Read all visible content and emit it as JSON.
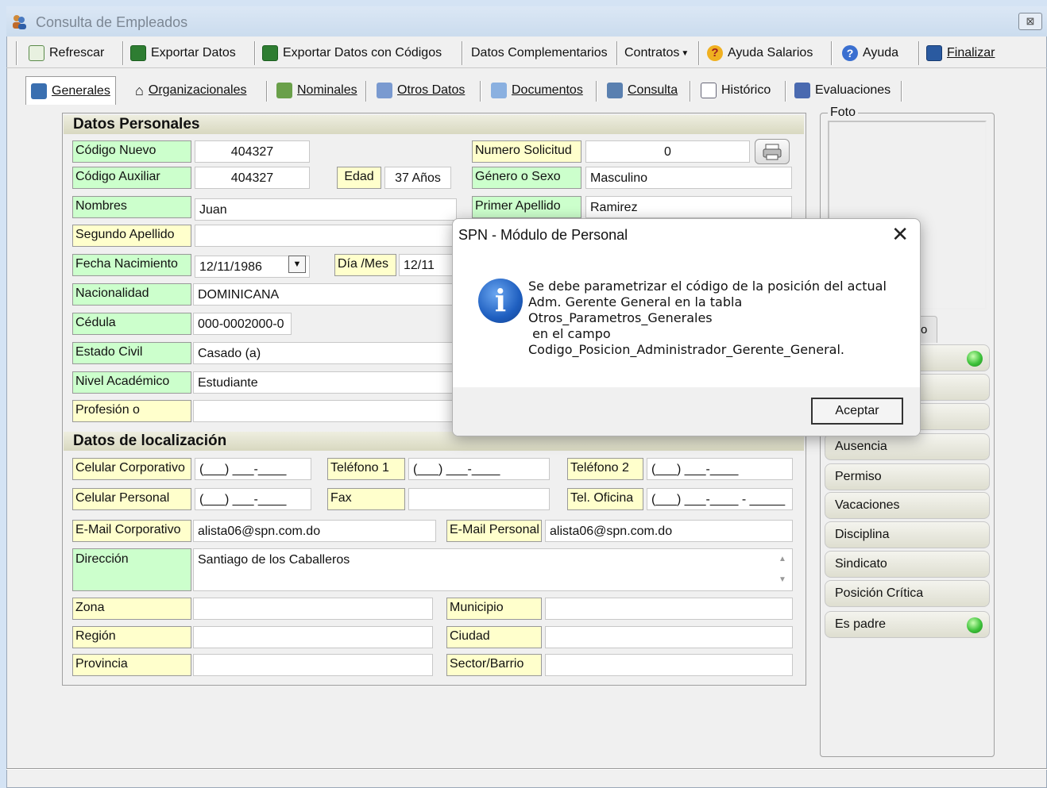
{
  "window": {
    "title": "Consulta de Empleados",
    "close": "⊠"
  },
  "toolbar": {
    "refresh": "Refrescar",
    "export": "Exportar Datos",
    "export_codes": "Exportar Datos con Códigos",
    "complementary": "Datos Complementarios",
    "contracts": "Contratos",
    "salary_help": "Ayuda Salarios",
    "help": "Ayuda",
    "finish": "Finalizar"
  },
  "tabs": {
    "generales": "Generales",
    "organizacionales": "Organizacionales",
    "nominales": "Nominales",
    "otros": "Otros Datos",
    "documentos": "Documentos",
    "consulta": "Consulta",
    "historico": "Histórico",
    "evaluaciones": "Evaluaciones"
  },
  "personal": {
    "section": "Datos Personales",
    "codigo_nuevo_lbl": "Código Nuevo",
    "codigo_nuevo": "404327",
    "codigo_aux_lbl": "Código Auxiliar",
    "codigo_aux": "404327",
    "edad_lbl": "Edad",
    "edad": "37 Años",
    "num_sol_lbl": "Numero Solicitud",
    "num_sol": "0",
    "genero_lbl": "Género o Sexo",
    "genero": "Masculino",
    "nombres_lbl": "Nombres",
    "nombres": "Juan",
    "apellido1_lbl": "Primer Apellido",
    "apellido1": "Ramirez",
    "apellido2_lbl": "Segundo Apellido",
    "apellido2": "",
    "fecha_lbl": "Fecha Nacimiento",
    "fecha": "12/11/1986",
    "diames_lbl": "Día /Mes",
    "diames": "12/11",
    "nacionalidad_lbl": "Nacionalidad",
    "nacionalidad": "DOMINICANA",
    "cedula_lbl": "Cédula",
    "cedula": "000-0002000-0",
    "estado_lbl": "Estado Civil",
    "estado": "Casado (a)",
    "nivel_lbl": "Nivel Académico",
    "nivel": "Estudiante",
    "profesion_lbl": "Profesión o",
    "profesion": ""
  },
  "location": {
    "section": "Datos de localización",
    "cel_corp_lbl": "Celular Corporativo",
    "cel_corp": "(___) ___-____",
    "tel1_lbl": "Teléfono 1",
    "tel1": "(___) ___-____",
    "tel2_lbl": "Teléfono 2",
    "tel2": "(___) ___-____",
    "cel_pers_lbl": "Celular Personal",
    "cel_pers": "(___) ___-____",
    "fax_lbl": "Fax",
    "fax": "",
    "tel_ofi_lbl": "Tel. Oficina",
    "tel_ofi": "(___) ___-____ - _____",
    "email_corp_lbl": "E-Mail Corporativo",
    "email_corp": "alista06@spn.com.do",
    "email_pers_lbl": "E-Mail Personal",
    "email_pers": "alista06@spn.com.do",
    "direccion_lbl": "Dirección",
    "direccion": "Santiago de los Caballeros",
    "zona_lbl": "Zona",
    "zona": "",
    "municipio_lbl": "Municipio",
    "municipio": "",
    "region_lbl": "Región",
    "region": "",
    "ciudad_lbl": "Ciudad",
    "ciudad": "",
    "provincia_lbl": "Provincia",
    "provincia": "",
    "sector_lbl": "Sector/Barrio",
    "sector": ""
  },
  "photo": {
    "label": "Foto",
    "tab_fragment": "o"
  },
  "side_buttons": {
    "ausencia": "Ausencia",
    "permiso": "Permiso",
    "vacaciones": "Vacaciones",
    "disciplina": "Disciplina",
    "sindicato": "Sindicato",
    "posicion": "Posición Crítica",
    "padre": "Es padre"
  },
  "dialog": {
    "title": "SPN - Módulo de Personal",
    "close": "✕",
    "icon": "i",
    "line1": "Se debe parametrizar el código de la posición del actual",
    "line2": "Adm. Gerente General en la tabla",
    "line3": "Otros_Parametros_Generales",
    "line4": " en el campo",
    "line5": "Codigo_Posicion_Administrador_Gerente_General.",
    "ok": "Aceptar"
  },
  "colors": {
    "label_green": "#ccffcc",
    "label_yellow": "#ffffcc",
    "led_green": "#3ec23a",
    "info_blue": "#1f5fc0"
  }
}
